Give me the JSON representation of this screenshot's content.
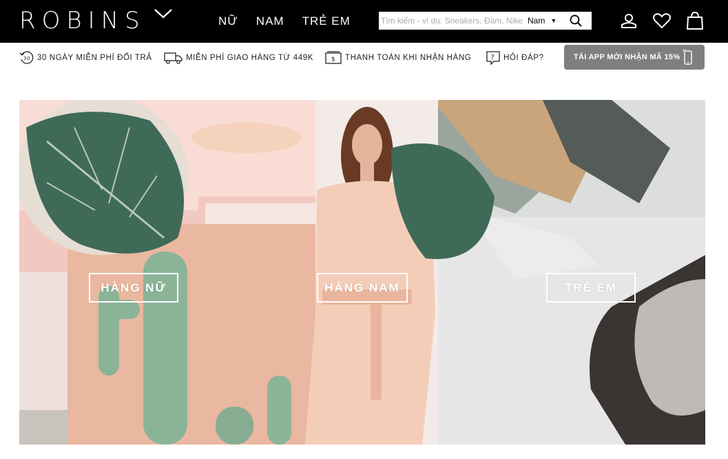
{
  "brand": {
    "logo_text": "ROBINS"
  },
  "nav": {
    "items": [
      "NỮ",
      "NAM",
      "TRẺ EM"
    ]
  },
  "search": {
    "placeholder": "Tìm kiếm - ví dụ: Sneakers, Đầm, Nike",
    "gender_selected": "Nam"
  },
  "icons": {
    "account": "user-icon",
    "wishlist": "heart-icon",
    "cart": "shopping-bag-icon",
    "search": "search-icon"
  },
  "benefits": {
    "return": "30 NGÀY MIỄN PHÍ ĐỔI TRẢ",
    "return_badge": "30",
    "shipping": "MIỄN PHÍ GIAO HÀNG TỪ 449K",
    "payment": "THANH TOÁN KHI NHẬN HÀNG",
    "faq": "HỎI ĐÁP?",
    "app_promo": "TẢI APP MỚI NHẬN MÃ 15%"
  },
  "hero": {
    "categories": [
      "HÀNG NỮ",
      "HÀNG NAM",
      "TRẺ EM"
    ]
  },
  "colors": {
    "topbar": "#000000",
    "app_button": "#7f7f7f",
    "hero_bg": "#f3e2da"
  }
}
